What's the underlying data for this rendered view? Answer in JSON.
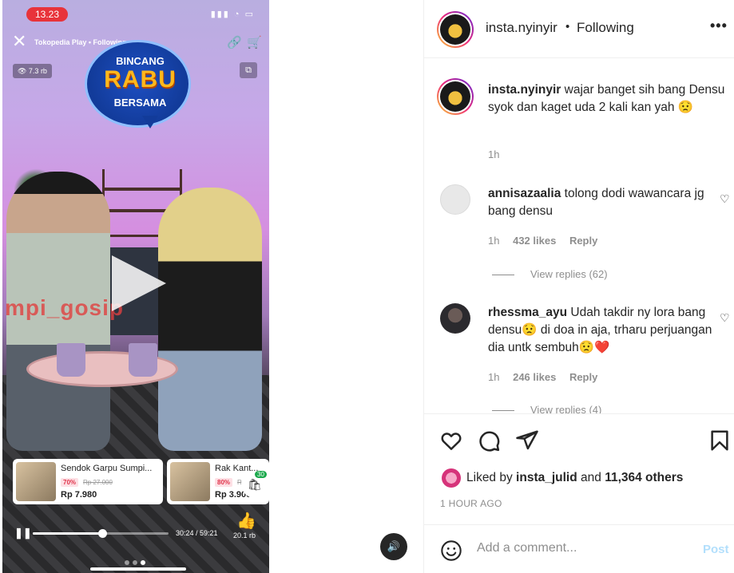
{
  "video": {
    "status_time": "13.23",
    "status_icons": "▮▮▮ ◔ ▭",
    "source": "Tokopedia Play • Following",
    "views": "👁 7.3 rb",
    "logo": {
      "line1": "BINCANG",
      "line2": "RABU",
      "line3": "BERSAMA"
    },
    "watermark": "mpi_gosip",
    "products": [
      {
        "name": "Sendok Garpu Sumpi...",
        "discount": "70%",
        "original_price": "Rp 27.000",
        "price": "Rp 7.980"
      },
      {
        "name": "Rak Kant...",
        "discount": "80%",
        "original_price": "Rp ...",
        "price": "Rp 3.900"
      }
    ],
    "bag_count": "30",
    "progress_fraction": 0.51,
    "time_label": "30:24 / 59:21",
    "likes": "20.1 rb",
    "page_dots": 3,
    "active_dot": 2
  },
  "post": {
    "username": "insta.nyinyir",
    "follow_state": "Following",
    "comments": [
      {
        "user": "insta.nyinyir",
        "text": "wajar banget sih bang Densu syok dan kaget uda 2 kali kan yah 😟",
        "time": "1h",
        "likes": "",
        "reply": ""
      },
      {
        "user": "annisazaalia",
        "text": "tolong dodi wawancara jg bang densu",
        "time": "1h",
        "likes": "432 likes",
        "reply": "Reply",
        "view_replies": "View replies (62)"
      },
      {
        "user": "rhessma_ayu",
        "text": "Udah takdir ny lora bang densu😟 di doa in aja, trharu perjuangan dia untk sembuh😟❤️",
        "time": "1h",
        "likes": "246 likes",
        "reply": "Reply",
        "view_replies": "View replies (4)"
      }
    ],
    "liked_by_prefix": "Liked by ",
    "liked_by_user": "insta_julid",
    "liked_by_mid": " and ",
    "liked_by_others": "11,364 others",
    "time_ago": "1 HOUR AGO",
    "add_comment_placeholder": "Add a comment...",
    "post_label": "Post"
  },
  "colors": {
    "accent": "#0095f6",
    "post_disabled": "#b2dffc",
    "live_red": "#e8333a"
  }
}
